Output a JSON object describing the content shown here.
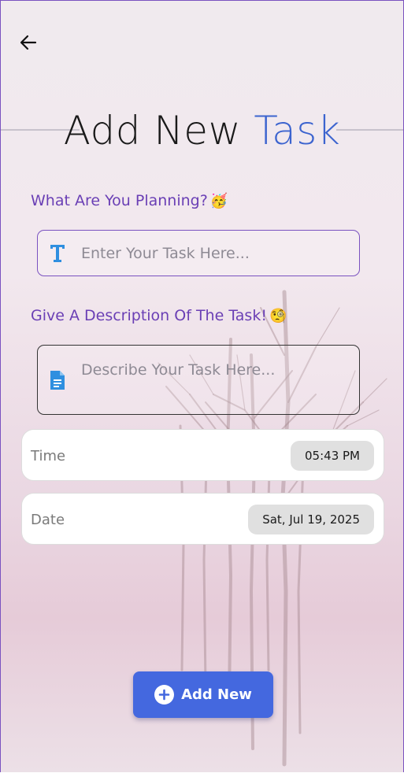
{
  "header": {
    "back_icon": "arrow-left-icon",
    "title_part1": "Add New",
    "title_part2": "Task",
    "accent_color": "#3c64cf"
  },
  "task_field": {
    "label": "What Are You Planning?",
    "label_emoji": "🥳",
    "icon": "text-t-icon",
    "placeholder": "Enter Your Task Here..."
  },
  "description_field": {
    "label": "Give A Description Of The Task!",
    "label_emoji": "🧐",
    "icon": "document-icon",
    "placeholder": "Describe Your Task Here..."
  },
  "time_card": {
    "label": "Time",
    "value": "05:43 PM"
  },
  "date_card": {
    "label": "Date",
    "value": "Sat, Jul 19, 2025"
  },
  "add_button": {
    "icon": "plus-circle-icon",
    "label": "Add New",
    "color": "#4468df"
  },
  "colors": {
    "label_purple": "#6a3fb5",
    "border_purple": "#7a52c0"
  }
}
